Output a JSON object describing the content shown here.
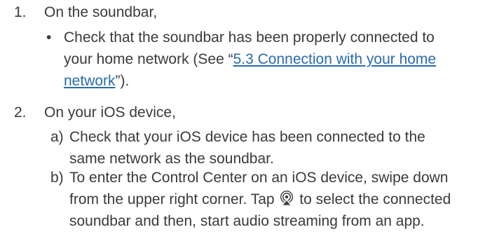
{
  "steps": [
    {
      "number": "1.",
      "heading": "On the soundbar,",
      "bullet": {
        "marker": "•",
        "line1": "Check that the soundbar has been properly connected to",
        "line2_pre": "your home network (See “",
        "link_part1": "5.3 Connection with your home",
        "link_part2": "network",
        "line3_post": "”)."
      }
    },
    {
      "number": "2.",
      "heading": "On your iOS device,",
      "items": [
        {
          "marker": "a)",
          "line1": "Check that your iOS device has been connected to the",
          "line2": "same network as the soundbar."
        },
        {
          "marker": "b)",
          "line1": "To enter the Control Center on an iOS device, swipe down",
          "line2_pre": "from the upper right corner. Tap",
          "icon": "airplay-audio-icon",
          "line2_post": "to select the connected",
          "line3": "soundbar and then, start audio streaming from an app."
        }
      ]
    }
  ],
  "colors": {
    "text": "#3a3a3a",
    "link": "#2a6bb0"
  }
}
